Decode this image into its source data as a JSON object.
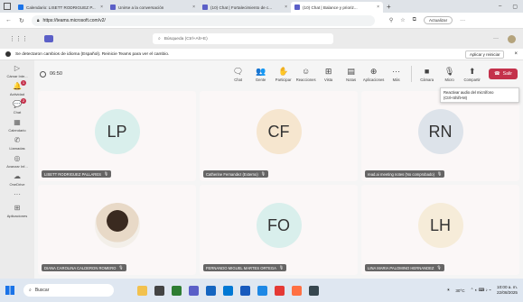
{
  "browser": {
    "tabs": [
      {
        "title": "Calendario: LISETT RODRIGUEZ P...",
        "icon_color": "#1a73e8",
        "active": false
      },
      {
        "title": "Unirse a la conversación",
        "icon_color": "#5b5fc7",
        "active": false
      },
      {
        "title": "(10) Chat | Fortalecimiento de c...",
        "icon_color": "#5b5fc7",
        "active": false
      },
      {
        "title": "(10) Chat | Balance y prioriz...",
        "icon_color": "#5b5fc7",
        "active": true
      }
    ],
    "url": "https://teams.microsoft.com/v2/",
    "update_label": "Actualizar"
  },
  "teams": {
    "search_placeholder": "Búsqueda (Ctrl+Alt+E)",
    "notice_text": "Se detectaron cambios de idioma (Español). Reinicie Teams para ver el cambio.",
    "notice_button": "Aplicar y reiniciar"
  },
  "rail": [
    {
      "icon": "camera-icon",
      "glyph": "▷",
      "label": "Cámar Inte..."
    },
    {
      "icon": "activity-icon",
      "glyph": "🔔",
      "label": "Actividad",
      "badge": "1"
    },
    {
      "icon": "chat-icon",
      "glyph": "💬",
      "label": "Chat",
      "badge": "2"
    },
    {
      "icon": "calendar-icon",
      "glyph": "▦",
      "label": "Calendario"
    },
    {
      "icon": "calls-icon",
      "glyph": "✆",
      "label": "Llamadas"
    },
    {
      "icon": "feedback-icon",
      "glyph": "◎",
      "label": "Avanzar Inf..."
    },
    {
      "icon": "onedrive-icon",
      "glyph": "☁",
      "label": "OneDrive"
    },
    {
      "icon": "more-icon",
      "glyph": "···",
      "label": ""
    },
    {
      "icon": "apps-icon",
      "glyph": "⊞",
      "label": "Aplicaciones"
    }
  ],
  "meeting": {
    "timer": "06:50",
    "controls": [
      {
        "icon": "chat-icon",
        "glyph": "🗨",
        "label": "Chat"
      },
      {
        "icon": "people-icon",
        "glyph": "👥",
        "label": "Gente"
      },
      {
        "icon": "raise-hand-icon",
        "glyph": "✋",
        "label": "Participar"
      },
      {
        "icon": "react-icon",
        "glyph": "☺",
        "label": "Reacciones"
      },
      {
        "icon": "view-icon",
        "glyph": "⊞",
        "label": "Vista"
      },
      {
        "icon": "notes-icon",
        "glyph": "▤",
        "label": "Notas"
      },
      {
        "icon": "apps-icon",
        "glyph": "⊕",
        "label": "Aplicaciones"
      },
      {
        "icon": "more-icon",
        "glyph": "···",
        "label": "Más"
      }
    ],
    "devices": [
      {
        "icon": "camera-off-icon",
        "glyph": "■",
        "label": "Cámara"
      },
      {
        "icon": "mic-off-icon",
        "glyph": "🎙",
        "label": "Micro"
      },
      {
        "icon": "share-icon",
        "glyph": "⬆",
        "label": "Compartir"
      }
    ],
    "leave_label": "Salir",
    "tooltip": "Reactivar audio del micrófono (Ctrl+Shift+M)"
  },
  "participants": [
    {
      "initials": "LP",
      "name": "LISETT RODRIGUEZ PALLARES",
      "circle_color": "#d9efec",
      "photo": false
    },
    {
      "initials": "CF",
      "name": "Catherine Fernandez (Externo)",
      "circle_color": "#f6e6cf",
      "photo": false
    },
    {
      "initials": "RN",
      "name": "read.ai meeting notes (No comprobado)",
      "circle_color": "#dde3ea",
      "photo": false
    },
    {
      "initials": "",
      "name": "DIANA CAROLINA CALDERON ROMERO",
      "circle_color": "#ffffff",
      "photo": true
    },
    {
      "initials": "FO",
      "name": "FERNANDO MIGUEL MARTES ORTEGA",
      "circle_color": "#d9efec",
      "photo": false
    },
    {
      "initials": "LH",
      "name": "LINA MARIA PALOMINO HERNANDEZ",
      "circle_color": "#f6ecd9",
      "photo": false
    }
  ],
  "taskbar": {
    "search_label": "Buscar",
    "weather": "30°C",
    "time": "10:00 a. m.",
    "date": "22/08/2025"
  }
}
